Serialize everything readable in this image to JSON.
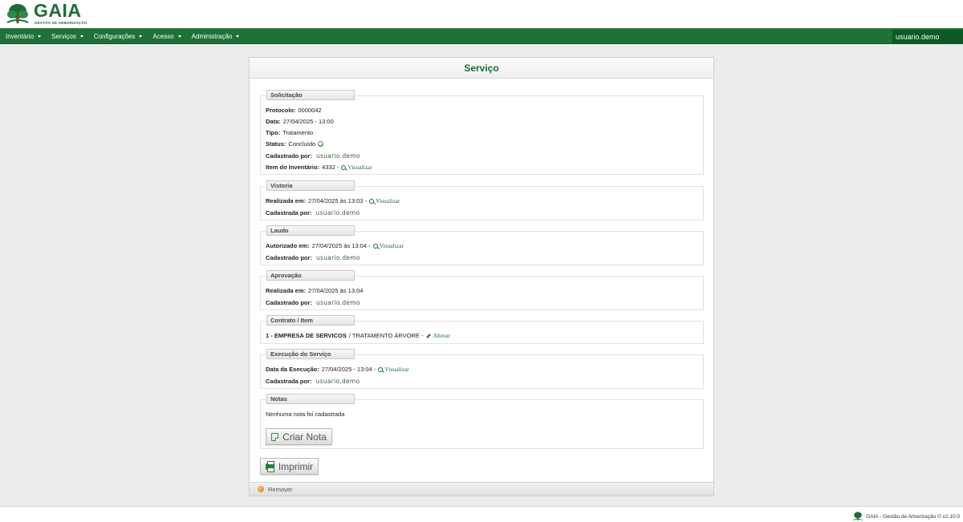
{
  "brand": {
    "name": "GAIA",
    "tagline": "GESTÃO DE ARBORIZAÇÃO"
  },
  "nav": {
    "items": [
      "Inventário",
      "Serviços",
      "Configurações",
      "Acesso",
      "Administração"
    ],
    "user": "usuario.demo"
  },
  "page": {
    "title": "Serviço"
  },
  "solicitacao": {
    "legend": "Solicitação",
    "protocolo_label": "Protocolo:",
    "protocolo": "0000042",
    "data_label": "Data:",
    "data": "27/04/2025 - 13:00",
    "tipo_label": "Tipo:",
    "tipo": "Tratamento",
    "status_label": "Status:",
    "status": "Concluído",
    "cadastrado_label": "Cadastrado por:",
    "cadastrado": "usuario.demo",
    "item_label": "Item do Inventário:",
    "item": "4332 -",
    "item_link": "Visualizar"
  },
  "vistoria": {
    "legend": "Vistoria",
    "realizada_label": "Realizada em:",
    "realizada": "27/04/2025 às 13:03 -",
    "link": "Visualizar",
    "cadastrada_label": "Cadastrada por:",
    "cadastrada": "usuario.demo"
  },
  "laudo": {
    "legend": "Laudo",
    "autorizado_label": "Autorizado em:",
    "autorizado": "27/04/2025 às 13:04 -",
    "link": "Visualizar",
    "cadastrado_label": "Cadastrado por:",
    "cadastrado": "usuario.demo"
  },
  "aprovacao": {
    "legend": "Aprovação",
    "realizada_label": "Realizada em:",
    "realizada": "27/04/2025 às 13:04",
    "cadastrado_label": "Cadastrado por:",
    "cadastrado": "usuario.demo"
  },
  "contrato": {
    "legend": "Contrato / Item",
    "empresa": "1 - EMPRESA DE SERVICOS",
    "item": "/ TRATAMENTO ÁRVORE -",
    "link": "Alterar"
  },
  "execucao": {
    "legend": "Execução do Serviço",
    "data_label": "Data da Execução:",
    "data": "27/04/2025 - 13:04 -",
    "link": "Visualizar",
    "cadastrada_label": "Cadastrada por:",
    "cadastrada": "usuario.demo"
  },
  "notas": {
    "legend": "Notas",
    "empty": "Nenhuma nota foi cadastrada",
    "criar": "Criar Nota"
  },
  "actions": {
    "imprimir": "Imprimir",
    "remover": "Remover"
  },
  "footer": {
    "text": "GAIA - Gestão de Arborização © v2.10.0"
  }
}
